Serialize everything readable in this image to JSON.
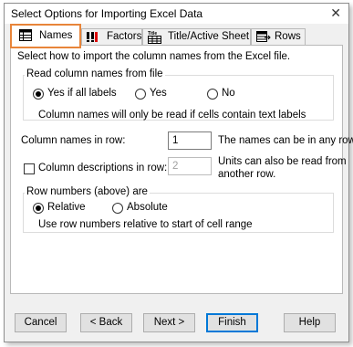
{
  "window": {
    "title": "Select Options for Importing Excel Data"
  },
  "tabs": [
    {
      "label": "Names",
      "icon": "table-icon",
      "active": true
    },
    {
      "label": "Factors",
      "icon": "factor-icon",
      "active": false
    },
    {
      "label": "Title/Active Sheet",
      "icon": "title-sheet-icon",
      "active": false
    },
    {
      "label": "Rows",
      "icon": "rows-icon",
      "active": false
    }
  ],
  "panel": {
    "intro": "Select how to import the column names from the Excel file.",
    "read_names": {
      "legend": "Read column names from file",
      "options": [
        "Yes if all labels",
        "Yes",
        "No"
      ],
      "selected": "Yes if all labels",
      "note": "Column names will only be read if cells contain text labels"
    },
    "names_row": {
      "label": "Column names in row:",
      "value": "1",
      "hint": "The names can be in any row."
    },
    "descriptions_row": {
      "label": "Column descriptions in row:",
      "checked": false,
      "value": "2",
      "hint_line1": "Units can also be read from",
      "hint_line2": "another row."
    },
    "row_numbers": {
      "legend": "Row numbers (above) are",
      "options": [
        "Relative",
        "Absolute"
      ],
      "selected": "Relative",
      "note": "Use row numbers relative to start of cell range"
    }
  },
  "buttons": {
    "cancel": "Cancel",
    "back": "< Back",
    "next": "Next >",
    "finish": "Finish",
    "help": "Help"
  },
  "colors": {
    "highlight": "#e8853a",
    "default_button_border": "#0078d7"
  }
}
